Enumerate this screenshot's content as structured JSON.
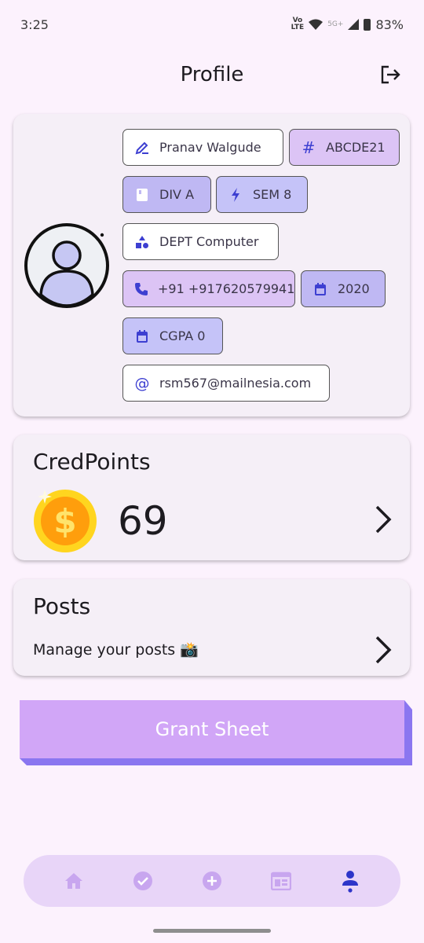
{
  "status": {
    "time": "3:25",
    "volte_line1": "Vo",
    "volte_line2": "LTE",
    "network": "5G+",
    "battery": "83%"
  },
  "header": {
    "title": "Profile"
  },
  "profile": {
    "name": "Pranav Walgude",
    "id": "ABCDE21",
    "division": "DIV A",
    "semester": "SEM 8",
    "department": "DEPT Computer",
    "phone": "+91 +917620579941",
    "year": "2020",
    "cgpa": "CGPA 0",
    "email": "rsm567@mailnesia.com"
  },
  "credpoints": {
    "title": "CredPoints",
    "value": "69"
  },
  "posts": {
    "title": "Posts",
    "subtitle": "Manage your posts 📸"
  },
  "grant": {
    "label": "Grant Sheet"
  },
  "nav": {
    "items": [
      "home-icon",
      "check-icon",
      "add-icon",
      "feed-icon",
      "profile-icon"
    ],
    "active": "profile-icon"
  },
  "colors": {
    "background": "#fcf2fd",
    "accent": "#3d3fd1",
    "grant": "#d1a6f7",
    "nav_inactive": "#c8a6ef"
  }
}
